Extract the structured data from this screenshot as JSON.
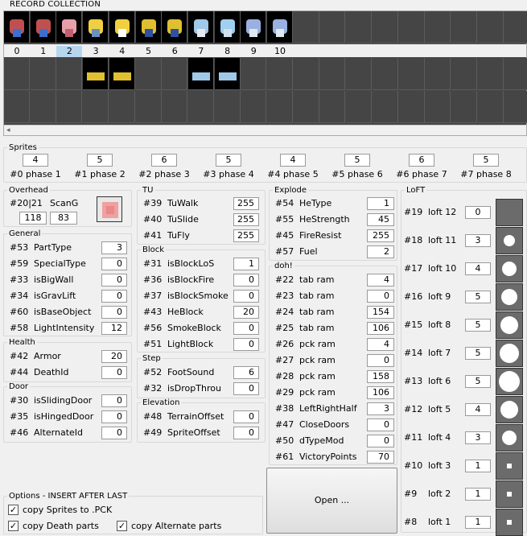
{
  "record": {
    "title": "RECORD COLLECTION",
    "indices": [
      "0",
      "1",
      "2",
      "3",
      "4",
      "5",
      "6",
      "7",
      "8",
      "9",
      "10"
    ],
    "selected_index": "2"
  },
  "sprites": {
    "title": "Sprites",
    "values": [
      "4",
      "5",
      "6",
      "5",
      "4",
      "5",
      "6",
      "5"
    ],
    "labels": [
      "#0 phase 1",
      "#1 phase 2",
      "#2 phase 3",
      "#3 phase 4",
      "#4 phase 5",
      "#5 phase 6",
      "#6 phase 7",
      "#7 phase 8"
    ]
  },
  "overhead": {
    "title": "Overhead",
    "id_label": "#20|21",
    "scang_label": "ScanG",
    "val1": "118",
    "val2": "83"
  },
  "general": {
    "title": "General",
    "rows": [
      {
        "id": "#53",
        "name": "PartType",
        "value": "3"
      },
      {
        "id": "#59",
        "name": "SpecialType",
        "value": "0"
      },
      {
        "id": "#33",
        "name": "isBigWall",
        "value": "0"
      },
      {
        "id": "#34",
        "name": "isGravLift",
        "value": "0"
      },
      {
        "id": "#60",
        "name": "isBaseObject",
        "value": "0"
      },
      {
        "id": "#58",
        "name": "LightIntensity",
        "value": "12"
      }
    ]
  },
  "health": {
    "title": "Health",
    "rows": [
      {
        "id": "#42",
        "name": "Armor",
        "value": "20"
      },
      {
        "id": "#44",
        "name": "DeathId",
        "value": "0"
      }
    ]
  },
  "door": {
    "title": "Door",
    "rows": [
      {
        "id": "#30",
        "name": "isSlidingDoor",
        "value": "0"
      },
      {
        "id": "#35",
        "name": "isHingedDoor",
        "value": "0"
      },
      {
        "id": "#46",
        "name": "AlternateId",
        "value": "0"
      }
    ]
  },
  "tu": {
    "title": "TU",
    "rows": [
      {
        "id": "#39",
        "name": "TuWalk",
        "value": "255"
      },
      {
        "id": "#40",
        "name": "TuSlide",
        "value": "255"
      },
      {
        "id": "#41",
        "name": "TuFly",
        "value": "255"
      }
    ]
  },
  "block": {
    "title": "Block",
    "rows": [
      {
        "id": "#31",
        "name": "isBlockLoS",
        "value": "1"
      },
      {
        "id": "#36",
        "name": "isBlockFire",
        "value": "0"
      },
      {
        "id": "#37",
        "name": "isBlockSmoke",
        "value": "0"
      },
      {
        "id": "#43",
        "name": "HeBlock",
        "value": "20"
      },
      {
        "id": "#56",
        "name": "SmokeBlock",
        "value": "0"
      },
      {
        "id": "#51",
        "name": "LightBlock",
        "value": "0"
      }
    ]
  },
  "step": {
    "title": "Step",
    "rows": [
      {
        "id": "#52",
        "name": "FootSound",
        "value": "6"
      },
      {
        "id": "#32",
        "name": "isDropThrou",
        "value": "0"
      }
    ]
  },
  "elevation": {
    "title": "Elevation",
    "rows": [
      {
        "id": "#48",
        "name": "TerrainOffset",
        "value": "0"
      },
      {
        "id": "#49",
        "name": "SpriteOffset",
        "value": "0"
      }
    ]
  },
  "explode": {
    "title": "Explode",
    "rows": [
      {
        "id": "#54",
        "name": "HeType",
        "value": "1"
      },
      {
        "id": "#55",
        "name": "HeStrength",
        "value": "45"
      },
      {
        "id": "#45",
        "name": "FireResist",
        "value": "255"
      },
      {
        "id": "#57",
        "name": "Fuel",
        "value": "2"
      }
    ]
  },
  "doh": {
    "title": "doh!",
    "rows": [
      {
        "id": "#22",
        "name": "tab ram",
        "value": "4"
      },
      {
        "id": "#23",
        "name": "tab ram",
        "value": "0"
      },
      {
        "id": "#24",
        "name": "tab ram",
        "value": "154"
      },
      {
        "id": "#25",
        "name": "tab ram",
        "value": "106"
      },
      {
        "id": "#26",
        "name": "pck ram",
        "value": "4"
      },
      {
        "id": "#27",
        "name": "pck ram",
        "value": "0"
      },
      {
        "id": "#28",
        "name": "pck ram",
        "value": "158"
      },
      {
        "id": "#29",
        "name": "pck ram",
        "value": "106"
      },
      {
        "id": "#38",
        "name": "LeftRightHalf",
        "value": "3"
      },
      {
        "id": "#47",
        "name": "CloseDoors",
        "value": "0"
      },
      {
        "id": "#50",
        "name": "dTypeMod",
        "value": "0"
      },
      {
        "id": "#61",
        "name": "VictoryPoints",
        "value": "70"
      }
    ]
  },
  "loft": {
    "title": "LoFT",
    "rows": [
      {
        "id": "#19",
        "name": "loft 12",
        "value": "0"
      },
      {
        "id": "#18",
        "name": "loft 11",
        "value": "3"
      },
      {
        "id": "#17",
        "name": "loft 10",
        "value": "4"
      },
      {
        "id": "#16",
        "name": "loft 9",
        "value": "5"
      },
      {
        "id": "#15",
        "name": "loft 8",
        "value": "5"
      },
      {
        "id": "#14",
        "name": "loft 7",
        "value": "5"
      },
      {
        "id": "#13",
        "name": "loft 6",
        "value": "5"
      },
      {
        "id": "#12",
        "name": "loft 5",
        "value": "4"
      },
      {
        "id": "#11",
        "name": "loft 4",
        "value": "3"
      },
      {
        "id": "#10",
        "name": "loft 3",
        "value": "1"
      },
      {
        "id": "#9",
        "name": "loft 2",
        "value": "1"
      },
      {
        "id": "#8",
        "name": "loft 1",
        "value": "1"
      }
    ]
  },
  "options": {
    "title": "Options - INSERT AFTER LAST",
    "copy_sprites": "copy Sprites to .PCK",
    "copy_death": "copy Death parts",
    "copy_alternate": "copy Alternate parts"
  },
  "open_button": "Open ...",
  "colors": {
    "selected_index_bg": "#b6d6ee",
    "empty_cell": "#454545",
    "loft_cell": "#6b6b6b"
  }
}
